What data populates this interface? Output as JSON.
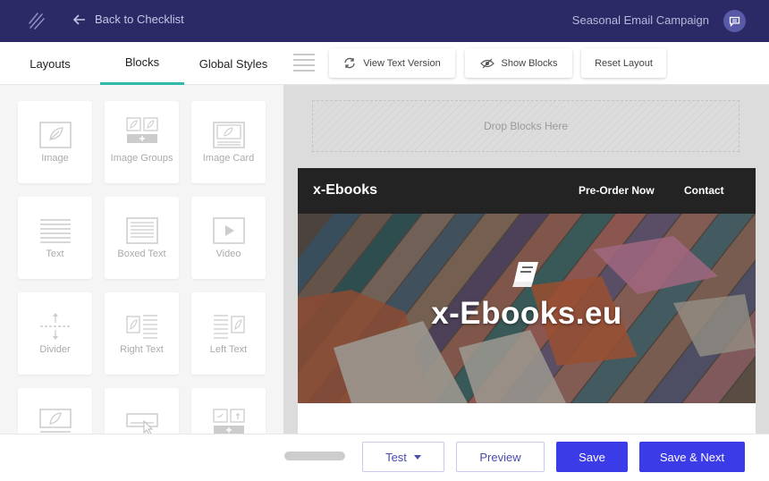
{
  "topbar": {
    "back_label": "Back to Checklist",
    "campaign_title": "Seasonal Email Campaign"
  },
  "tabs": [
    {
      "label": "Layouts"
    },
    {
      "label": "Blocks"
    },
    {
      "label": "Global Styles"
    }
  ],
  "toolbar": {
    "view_text_label": "View Text Version",
    "show_blocks_label": "Show Blocks",
    "reset_layout_label": "Reset Layout"
  },
  "blocks": [
    {
      "label": "Image",
      "icon": "image-icon"
    },
    {
      "label": "Image Groups",
      "icon": "image-groups-icon"
    },
    {
      "label": "Image Card",
      "icon": "image-card-icon"
    },
    {
      "label": "Text",
      "icon": "text-icon"
    },
    {
      "label": "Boxed Text",
      "icon": "boxed-text-icon"
    },
    {
      "label": "Video",
      "icon": "video-icon"
    },
    {
      "label": "Divider",
      "icon": "divider-icon"
    },
    {
      "label": "Right Text",
      "icon": "right-text-icon"
    },
    {
      "label": "Left Text",
      "icon": "left-text-icon"
    }
  ],
  "canvas": {
    "drop_label": "Drop Blocks Here",
    "email_brand": "x-Ebooks",
    "nav_links": [
      "Pre-Order Now",
      "Contact"
    ],
    "hero_title": "x-Ebooks.eu"
  },
  "bottom": {
    "test_label": "Test",
    "preview_label": "Preview",
    "save_label": "Save",
    "save_next_label": "Save & Next"
  },
  "colors": {
    "topbar": "#2b2a66",
    "accent_tab": "#30b8a8",
    "primary_button": "#3b3be8"
  }
}
